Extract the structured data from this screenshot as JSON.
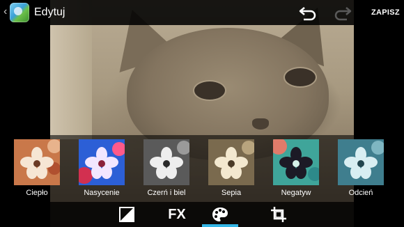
{
  "header": {
    "title": "Edytuj",
    "save_label": "ZAPISZ",
    "icons": [
      "back-chevron-icon",
      "app-gallery-icon",
      "undo-icon",
      "redo-icon"
    ]
  },
  "filters": {
    "items": [
      {
        "label": "Ciepło",
        "style": "warm"
      },
      {
        "label": "Nasycenie",
        "style": "saturated"
      },
      {
        "label": "Czerń i biel",
        "style": "bw"
      },
      {
        "label": "Sepia",
        "style": "sepia"
      },
      {
        "label": "Negatyw",
        "style": "negative"
      },
      {
        "label": "Odcień",
        "style": "tint"
      }
    ]
  },
  "toolbar": {
    "tools": [
      "exposure-icon",
      "fx-tool",
      "color-palette-icon",
      "crop-icon"
    ],
    "fx_label": "FX",
    "active": "color-palette-icon",
    "accent": "#33b5e5"
  }
}
